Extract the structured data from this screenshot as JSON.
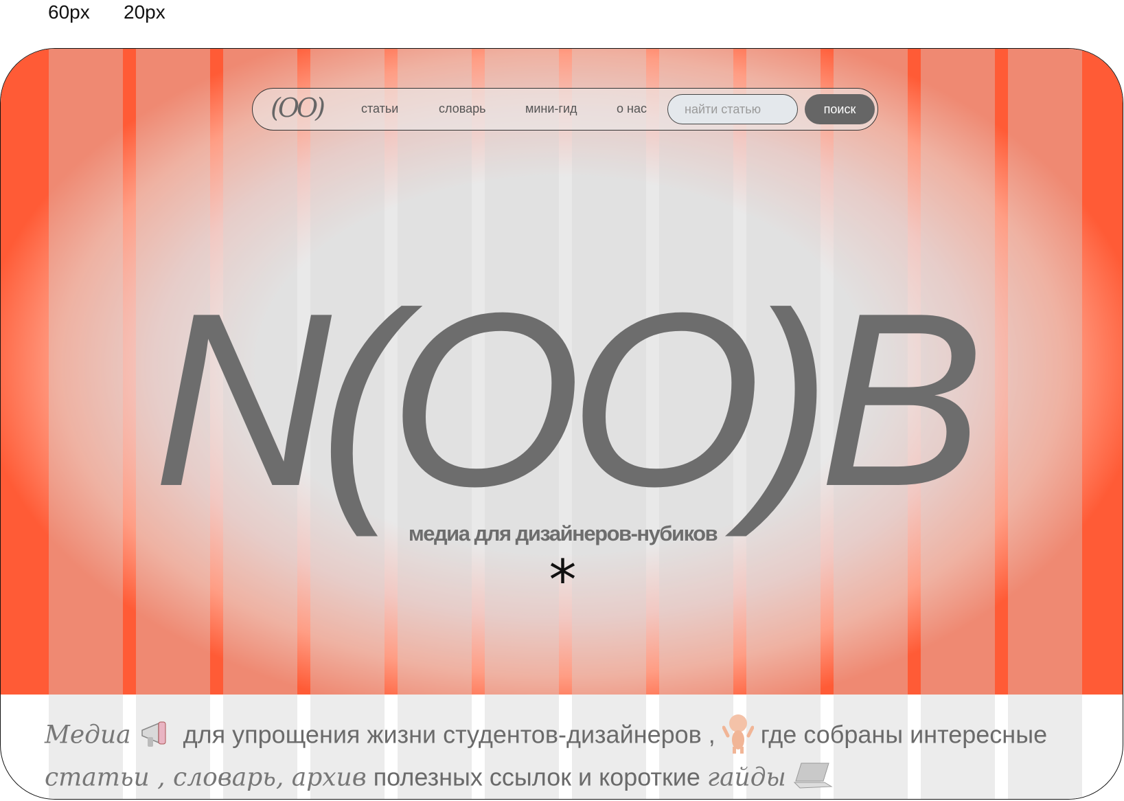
{
  "grid_labels": {
    "column": "60px",
    "gutter": "20px"
  },
  "nav": {
    "logo": "(OO)",
    "links": [
      "статьи",
      "словарь",
      "мини-гид",
      "о нас"
    ],
    "search_placeholder": "найти статью",
    "search_button": "поиск"
  },
  "hero": {
    "title": "N(OO)B",
    "tagline": "медиа для дизайнеров-нубиков",
    "asterisk": "*"
  },
  "intro": {
    "w1": "Медиа",
    "t1": " для упрощения жизни студентов-дизайнеров ,",
    "t2": " где собраны интересные",
    "w2": "статьи",
    "t3": " , ",
    "w3": "словарь, архив",
    "t4": " полезных ссылок и короткие ",
    "w4": "гайды"
  },
  "colors": {
    "accent": "#ff5b36",
    "hero_center": "#e9e9e9",
    "logo_gray": "#6d6d6d",
    "button_bg": "#666666"
  },
  "icons": [
    "megaphone-icon",
    "doll-icon",
    "laptop-icon"
  ]
}
